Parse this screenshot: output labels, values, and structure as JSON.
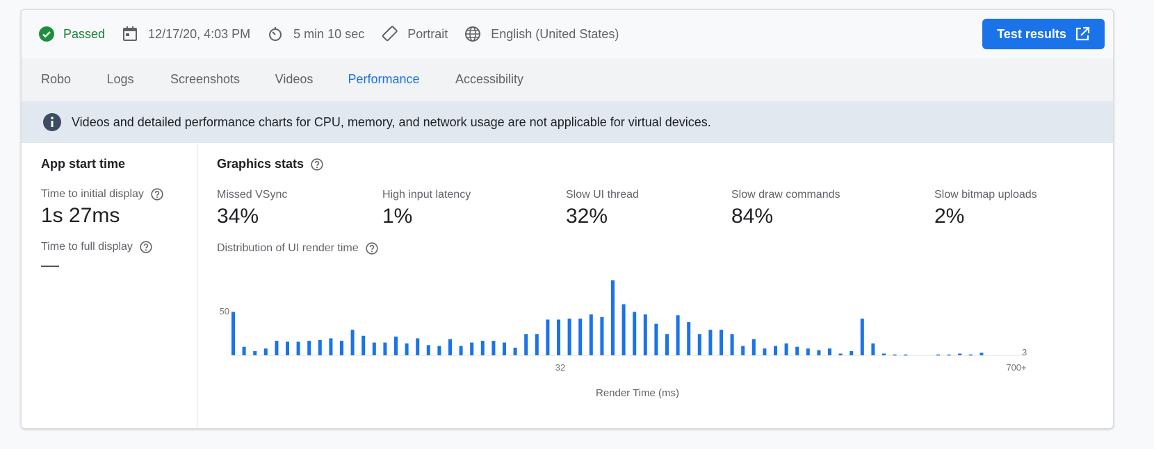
{
  "status": {
    "result": "Passed",
    "date": "12/17/20, 4:03 PM",
    "duration": "5 min 10 sec",
    "orientation": "Portrait",
    "locale": "English (United States)",
    "test_results_label": "Test results"
  },
  "tabs": [
    {
      "label": "Robo"
    },
    {
      "label": "Logs"
    },
    {
      "label": "Screenshots"
    },
    {
      "label": "Videos"
    },
    {
      "label": "Performance"
    },
    {
      "label": "Accessibility"
    }
  ],
  "active_tab": "Performance",
  "banner": {
    "text": "Videos and detailed performance charts for CPU, memory, and network usage are not applicable for virtual devices."
  },
  "app_start": {
    "title": "App start time",
    "initial_label": "Time to initial display",
    "initial_value": "1s 27ms",
    "full_label": "Time to full display",
    "full_value": "—"
  },
  "graphics": {
    "title": "Graphics stats",
    "stats": [
      {
        "label": "Missed VSync",
        "value": "34%"
      },
      {
        "label": "High input latency",
        "value": "1%"
      },
      {
        "label": "Slow UI thread",
        "value": "32%"
      },
      {
        "label": "Slow draw commands",
        "value": "84%"
      },
      {
        "label": "Slow bitmap uploads",
        "value": "2%"
      }
    ],
    "distribution_label": "Distribution of UI render time"
  },
  "colors": {
    "accent": "#1a73e8",
    "passed": "#188038",
    "banner_bg": "#e1e8f0"
  },
  "chart_data": {
    "type": "bar",
    "xlabel": "Render Time (ms)",
    "ylabel": "",
    "x_tick_labels": [
      "32",
      "700+"
    ],
    "y_tick_labels": [
      "50"
    ],
    "end_value_label": "3",
    "ylim": [
      0,
      88
    ],
    "values": [
      51,
      10,
      5,
      8,
      17,
      16,
      16,
      17,
      18,
      20,
      17,
      30,
      23,
      15,
      15,
      22,
      14,
      20,
      12,
      11,
      19,
      11,
      15,
      17,
      17,
      15,
      9,
      25,
      25,
      42,
      42,
      43,
      43,
      48,
      45,
      88,
      60,
      51,
      48,
      37,
      25,
      47,
      39,
      25,
      30,
      30,
      25,
      11,
      19,
      8,
      11,
      14,
      10,
      8,
      6,
      8,
      2,
      5,
      43,
      14,
      2,
      1,
      1,
      0,
      0,
      1,
      1,
      2,
      1,
      3
    ]
  }
}
